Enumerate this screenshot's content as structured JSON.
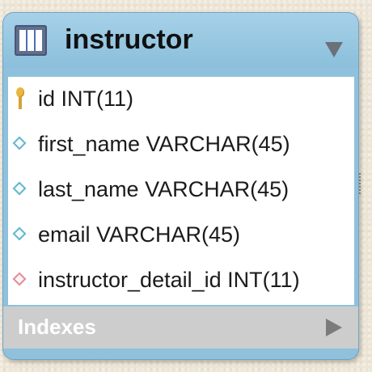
{
  "entity": {
    "title": "instructor",
    "columns": [
      {
        "text": "id INT(11)",
        "kind": "primary-key",
        "icon": "key-icon"
      },
      {
        "text": "first_name VARCHAR(45)",
        "kind": "attribute",
        "icon": "diamond-icon"
      },
      {
        "text": "last_name VARCHAR(45)",
        "kind": "attribute",
        "icon": "diamond-icon"
      },
      {
        "text": "email VARCHAR(45)",
        "kind": "attribute",
        "icon": "diamond-icon"
      },
      {
        "text": "instructor_detail_id INT(11)",
        "kind": "foreign-key",
        "icon": "diamond-icon"
      }
    ],
    "indexes_label": "Indexes"
  },
  "colors": {
    "header": "#8fc1dc",
    "attribute_icon": "#64b6cc",
    "foreign_key_icon": "#e08d98",
    "key_icon": "#e9b640",
    "indexes_bar": "#cdcdcd"
  }
}
